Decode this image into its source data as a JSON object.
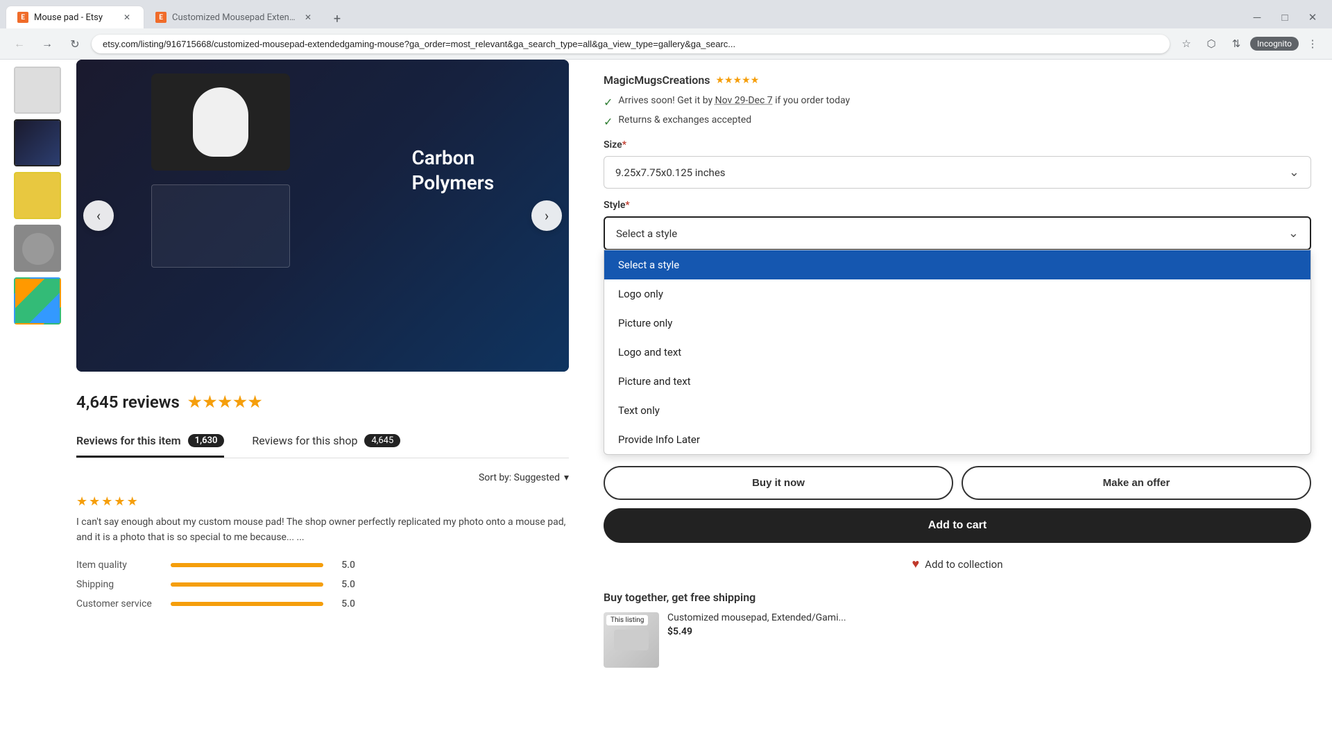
{
  "browser": {
    "tabs": [
      {
        "id": "tab1",
        "favicon": "E",
        "title": "Mouse pad - Etsy",
        "active": true
      },
      {
        "id": "tab2",
        "favicon": "E",
        "title": "Customized Mousepad Extende...",
        "active": false
      }
    ],
    "address": "etsy.com/listing/916715668/customized-mousepad-extendedgaming-mouse?ga_order=most_relevant&ga_search_type=all&ga_view_type=gallery&ga_searc...",
    "incognito_label": "Incognito"
  },
  "product": {
    "shop_name": "MagicMugsCreations",
    "shop_stars": "★★★★★",
    "delivery_line1": "Arrives soon! Get it by ",
    "delivery_date": "Nov 29-Dec 7",
    "delivery_line2": " if you order today",
    "delivery_returns": "Returns & exchanges accepted",
    "size_label": "Size",
    "size_value": "9.25x7.75x0.125 inches",
    "style_label": "Style",
    "style_placeholder": "Select a style",
    "style_options": [
      {
        "value": "select",
        "label": "Select a style",
        "selected": true
      },
      {
        "value": "logo_only",
        "label": "Logo only",
        "selected": false
      },
      {
        "value": "picture_only",
        "label": "Picture only",
        "selected": false
      },
      {
        "value": "logo_text",
        "label": "Logo and text",
        "selected": false
      },
      {
        "value": "picture_text",
        "label": "Picture and text",
        "selected": false
      },
      {
        "value": "text_only",
        "label": "Text only",
        "selected": false
      },
      {
        "value": "provide_later",
        "label": "Provide Info Later",
        "selected": false
      }
    ],
    "btn_buy_now": "Buy it now",
    "btn_make_offer": "Make an offer",
    "btn_add_cart": "Add to cart",
    "btn_collection": "Add to collection",
    "upsell_title": "Buy together, get free shipping",
    "upsell_badge": "This listing",
    "upsell_name": "Customized mousepad, Extended/Gami...",
    "upsell_price": "$5.49"
  },
  "reviews": {
    "count": "4,645 reviews",
    "tab_item_label": "Reviews for this item",
    "tab_item_count": "1,630",
    "tab_shop_label": "Reviews for this shop",
    "tab_shop_count": "4,645",
    "sort_label": "Sort by: Suggested",
    "first_review": {
      "text": "I can't say enough about my custom mouse pad!   The shop owner perfectly replicated my photo onto a mouse pad, and it is a photo that is so special to me because...",
      "more": "..."
    },
    "item_quality_label": "Item quality",
    "item_quality_value": "5.0",
    "shipping_label": "Shipping",
    "shipping_value": "5.0",
    "customer_service_label": "Customer service",
    "customer_service_value": "5.0"
  },
  "image": {
    "brand_line1": "Carbon",
    "brand_line2": "Polymers"
  }
}
